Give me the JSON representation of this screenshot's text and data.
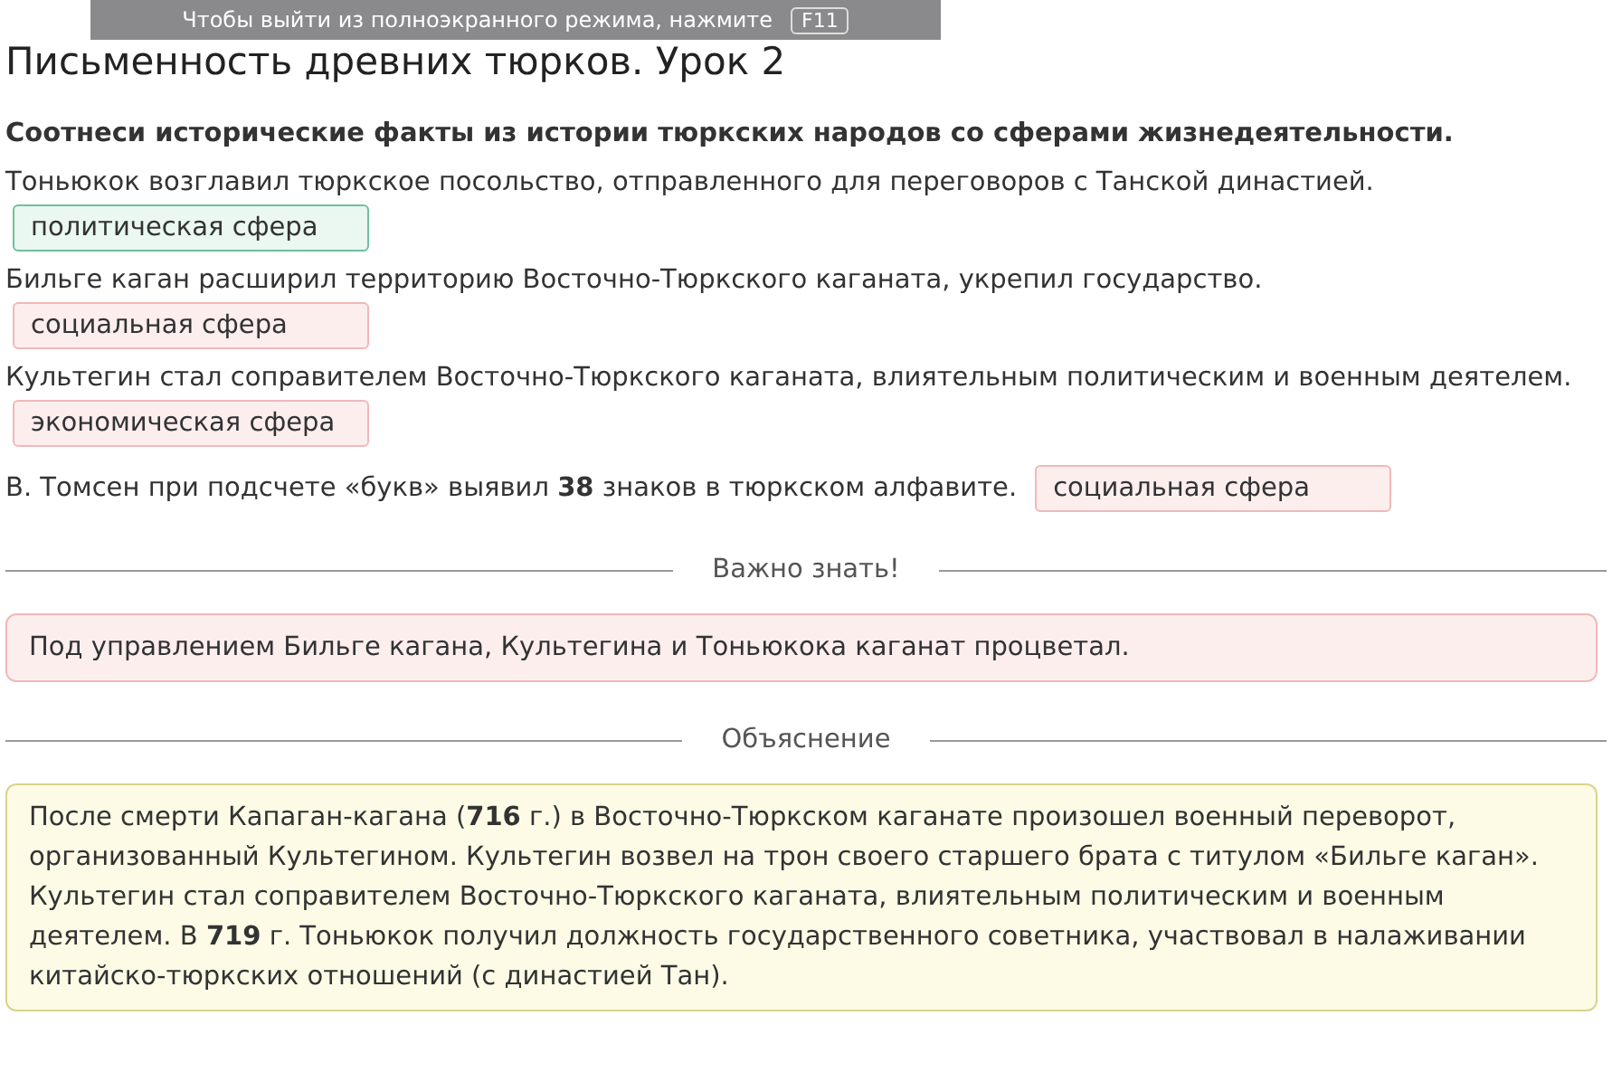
{
  "fullscreen_banner": {
    "text": "Чтобы выйти из полноэкранного режима, нажмите",
    "key": "F11"
  },
  "title": "Письменность древних тюрков. Урок 2",
  "question": "Соотнеси исторические факты из истории тюркских народов со сферами жизнедеятельности.",
  "items": [
    {
      "kind": "block",
      "text": "Тоньюкок возглавил тюркское посольство, отправленного для переговоров с Танской династией.",
      "answer": "политическая сфера",
      "correct": true
    },
    {
      "kind": "block",
      "text": "Бильге каган расширил территорию Восточно-Тюркского каганата, укрепил государство.",
      "answer": "социальная сфера",
      "correct": false
    },
    {
      "kind": "block",
      "text": "Культегин стал соправителем Восточно-Тюркского каганата, влиятельным политическим и военным деятелем.",
      "answer": "экономическая сфера",
      "correct": false
    },
    {
      "kind": "inline",
      "text": "В. Томсен при подсчете «букв» выявил **38** знаков в тюркском алфавите.",
      "answer": "социальная сфера",
      "correct": false
    }
  ],
  "important": {
    "heading": "Важно знать!",
    "text": "Под управлением Бильге кагана, Культегина и Тоньюкока каганат процветал."
  },
  "explanation": {
    "heading": "Объяснение",
    "text": "После смерти Капаган-кагана (**716** г.) в Восточно-Тюркском каганате произошел военный переворот, организованный Культегином. Культегин возвел на трон своего старшего брата с титулом «Бильге каган». Культегин стал соправителем Восточно-Тюркского каганата, влиятельным политическим и военным деятелем. В **719** г. Тоньюкок получил должность государственного советника, участвовал в налаживании китайско-тюркских отношений (с династией Тан)."
  }
}
